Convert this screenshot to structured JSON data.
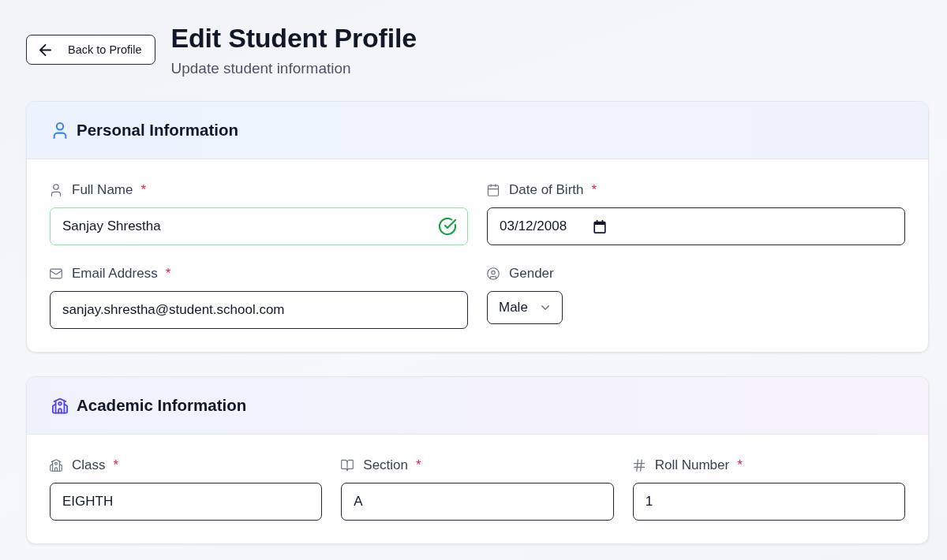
{
  "back_button": {
    "label": "Back to Profile"
  },
  "header": {
    "title": "Edit Student Profile",
    "subtitle": "Update student information"
  },
  "sections": [
    {
      "title": "Personal Information",
      "rows": [
        [
          {
            "kind": "text",
            "label": "Full Name",
            "required_mark": "*",
            "value": "Sanjay Shrestha",
            "valid": true
          },
          {
            "kind": "date",
            "label": "Date of Birth",
            "required_mark": "*",
            "value": "03/12/2008",
            "valid": false
          }
        ],
        [
          {
            "kind": "text",
            "label": "Email Address",
            "required_mark": "*",
            "value": "sanjay.shrestha@student.school.com",
            "valid": false
          },
          {
            "kind": "select",
            "label": "Gender",
            "value": "Male",
            "valid": false
          }
        ]
      ]
    },
    {
      "title": "Academic Information",
      "rows": [
        [
          {
            "kind": "text",
            "label": "Class",
            "required_mark": "*",
            "value": "EIGHTH",
            "valid": false
          },
          {
            "kind": "text",
            "label": "Section",
            "required_mark": "*",
            "value": "A",
            "valid": false
          },
          {
            "kind": "text",
            "label": "Roll Number",
            "required_mark": "*",
            "value": "1",
            "valid": false
          }
        ]
      ]
    }
  ]
}
